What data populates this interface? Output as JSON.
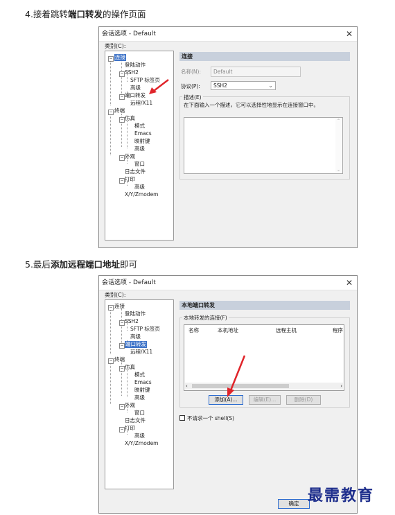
{
  "step4": {
    "prefix": "4.接着跳转",
    "bold": "端口转发",
    "suffix": "的操作页面"
  },
  "step5": {
    "prefix": "5.最后",
    "bold": "添加远程端口地址",
    "suffix": "即可"
  },
  "dialog1": {
    "title": "会话选项 - Default",
    "category_label": "类别(C):",
    "tree": [
      "连接",
      "登陆动作",
      "SSH2",
      "SFTP 标签页",
      "高级",
      "端口转发",
      "远程/X11",
      "终端",
      "仿真",
      "模式",
      "Emacs",
      "映射键",
      "高级",
      "外观",
      "窗口",
      "日志文件",
      "打印",
      "高级",
      "X/Y/Zmodem"
    ],
    "panel_title": "连接",
    "name_label": "名称(N):",
    "name_value": "Default",
    "protocol_label": "协议(P):",
    "protocol_value": "SSH2",
    "desc_label": "描述(E)",
    "desc_hint": "在下面输入一个描述，它可以选择性地显示在连接窗口中。"
  },
  "dialog2": {
    "title": "会话选项 - Default",
    "category_label": "类别(C):",
    "tree": [
      "连接",
      "登陆动作",
      "SSH2",
      "SFTP 标签页",
      "高级",
      "端口转发",
      "远程/X11",
      "终端",
      "仿真",
      "模式",
      "Emacs",
      "映射键",
      "高级",
      "外观",
      "窗口",
      "日志文件",
      "打印",
      "高级",
      "X/Y/Zmodem"
    ],
    "panel_title": "本地端口转发",
    "group_label": "本地转发的连接(F)",
    "columns": [
      "名称",
      "本机地址",
      "远程主机",
      "程序"
    ],
    "add_button": "添加(A)...",
    "edit_button": "编辑(E)...",
    "delete_button": "删除(D)",
    "checkbox_label": "不请求一个 shell(S)",
    "ok_button": "确定"
  },
  "watermark": "最需教育",
  "colors": {
    "selection": "#3f74c8",
    "arrow": "#e0242a",
    "panel_header": "#c8d0dc",
    "watermark": "#1e2e8c"
  }
}
